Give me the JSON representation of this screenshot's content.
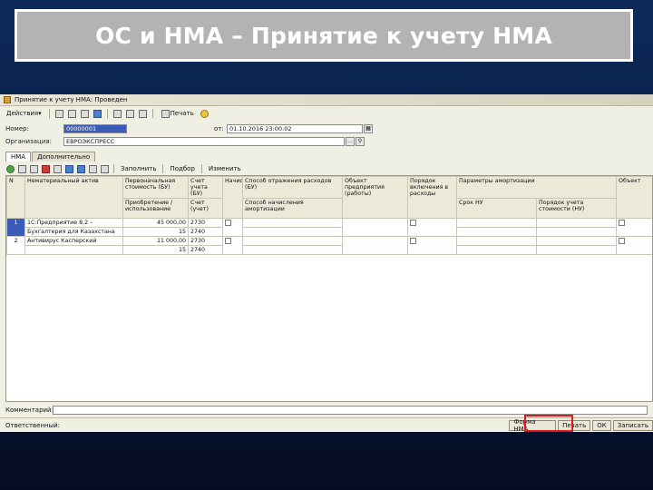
{
  "slide": {
    "title": "ОС и НМА – Принятие к учету НМА"
  },
  "window": {
    "title": "Принятие к учету НМА: Проведен"
  },
  "toolbar": {
    "actions_label": "Действия",
    "print_label": "Печать"
  },
  "fields": {
    "number_label": "Номер:",
    "number_value": "00000001",
    "date_label": "от:",
    "date_value": "01.10.2016 23:00:02",
    "org_label": "Организация:",
    "org_value": "ЕВРОЭКСПРЕСС"
  },
  "tabs": [
    {
      "label": "НМА"
    },
    {
      "label": "Дополнительно"
    }
  ],
  "grid_toolbar": {
    "fill_label": "Заполнить",
    "selection_label": "Подбор",
    "change_label": "Изменить"
  },
  "table": {
    "headers_top": [
      "N",
      "Нематериальный актив",
      "Первоначальная стоимость (БУ)",
      "Счет учета (БУ)",
      "Начислять",
      "Способ отражения расходов (БУ)",
      "Объект предприятия (работы)",
      "Порядок включения в расходы",
      "Параметры амортизации",
      "Объект"
    ],
    "headers_bottom": [
      "Приобретение / использование",
      "Счет (учет)",
      "Способ начисления амортизации",
      "Срок НУ",
      "Порядок учета стоимости (НУ)"
    ],
    "rows": [
      {
        "n": "1",
        "name": "1С:Предприятие 8.2 –",
        "name2": "Бухгалтерия для Казахстана",
        "cost": "45 000,00",
        "cost2": "15",
        "acc": "2730",
        "acc2": "2740"
      },
      {
        "n": "2",
        "name": "Антивирус Касперский",
        "name2": "",
        "cost": "11 000,00",
        "cost2": "15",
        "acc": "2730",
        "acc2": "2740"
      }
    ]
  },
  "comment_label": "Комментарий:",
  "status_bar": {
    "left": "Ответственный:",
    "buttons": [
      "Форма НМА",
      "Печать",
      "ОК",
      "Записать"
    ]
  },
  "colors": {
    "highlight": "#e01818",
    "title_box": "#b3b3b3",
    "selection": "#3a5bb8"
  }
}
